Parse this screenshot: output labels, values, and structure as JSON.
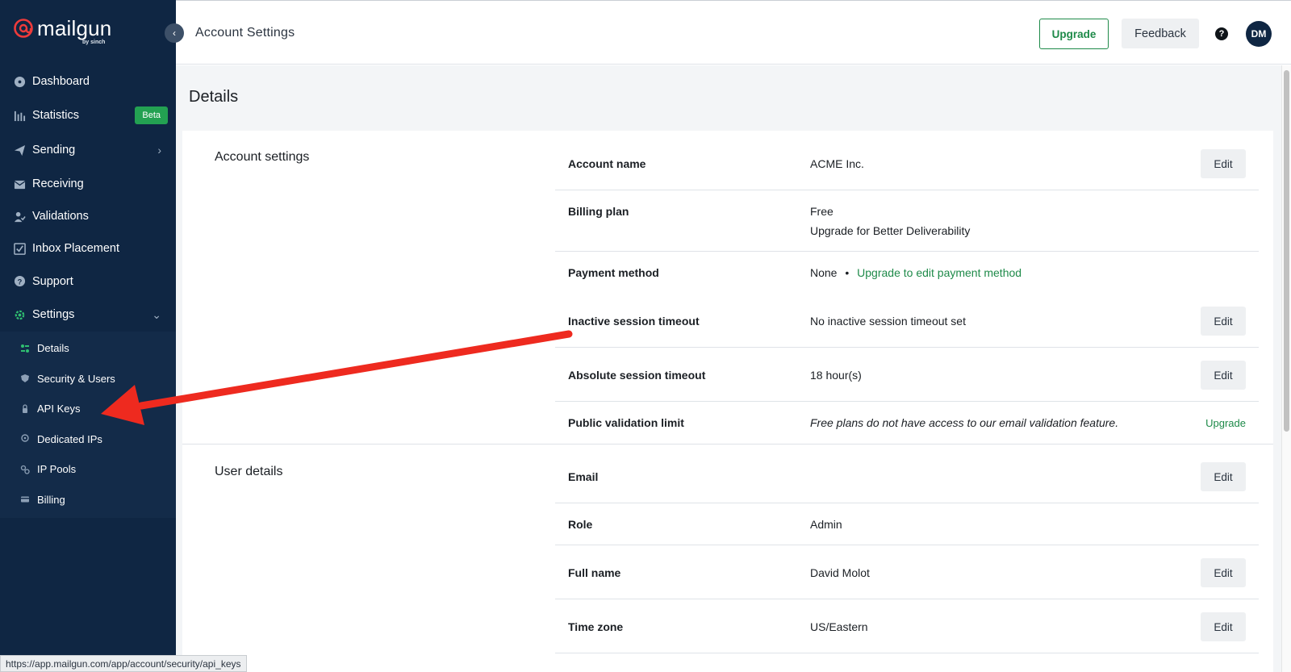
{
  "brand": {
    "name": "mailgun",
    "sub": "by sinch"
  },
  "sidebar": {
    "items": [
      {
        "label": "Dashboard",
        "icon": "dashboard-icon"
      },
      {
        "label": "Statistics",
        "icon": "statistics-icon",
        "badge": "Beta"
      },
      {
        "label": "Sending",
        "icon": "sending-icon"
      },
      {
        "label": "Receiving",
        "icon": "receiving-icon"
      },
      {
        "label": "Validations",
        "icon": "validations-icon"
      },
      {
        "label": "Inbox Placement",
        "icon": "inbox-placement-icon"
      },
      {
        "label": "Support",
        "icon": "support-icon"
      },
      {
        "label": "Settings",
        "icon": "settings-icon"
      }
    ],
    "subitems": [
      {
        "label": "Details",
        "icon": "details-icon"
      },
      {
        "label": "Security & Users",
        "icon": "shield-icon"
      },
      {
        "label": "API Keys",
        "icon": "key-icon"
      },
      {
        "label": "Dedicated IPs",
        "icon": "location-pin-icon"
      },
      {
        "label": "IP Pools",
        "icon": "ip-pools-icon"
      },
      {
        "label": "Billing",
        "icon": "credit-card-icon"
      }
    ]
  },
  "header": {
    "title": "Account Settings",
    "upgrade": "Upgrade",
    "feedback": "Feedback",
    "help": "?",
    "avatar": "DM"
  },
  "main": {
    "heading": "Details",
    "account_section": {
      "title": "Account settings",
      "rows": [
        {
          "label": "Account name",
          "value": "ACME Inc.",
          "action": "Edit"
        },
        {
          "label": "Billing plan",
          "value": "Free",
          "link": "Upgrade for Better Deliverability"
        },
        {
          "label": "Payment method",
          "value": "None",
          "link": "Upgrade to edit payment method"
        },
        {
          "label": "Inactive session timeout",
          "value": "No inactive session timeout set",
          "action": "Edit"
        },
        {
          "label": "Absolute session timeout",
          "value": "18 hour(s)",
          "action": "Edit"
        },
        {
          "label": "Public validation limit",
          "value": "Free plans do not have access to our email validation feature.",
          "link": "Upgrade"
        }
      ]
    },
    "user_section": {
      "title": "User details",
      "rows": [
        {
          "label": "Email",
          "value": "",
          "action": "Edit"
        },
        {
          "label": "Role",
          "value": "Admin"
        },
        {
          "label": "Full name",
          "value": "David Molot",
          "action": "Edit"
        },
        {
          "label": "Time zone",
          "value": "US/Eastern",
          "action": "Edit"
        }
      ]
    }
  },
  "status_url": "https://app.mailgun.com/app/account/security/api_keys",
  "colors": {
    "sidebar": "#0f2643",
    "accent": "#1e8a49",
    "arrow": "#ee2a1f"
  }
}
